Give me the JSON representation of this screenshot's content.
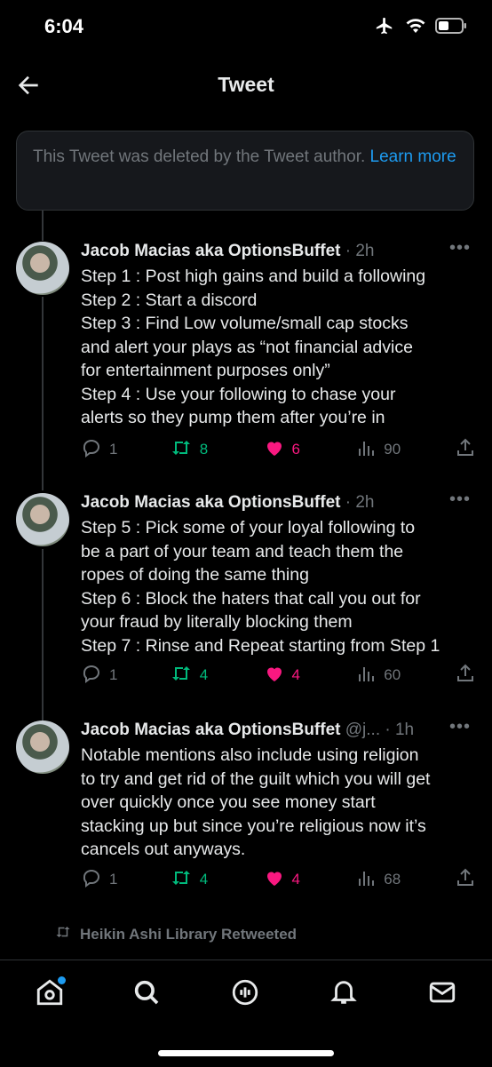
{
  "status_bar": {
    "time": "6:04"
  },
  "header": {
    "title": "Tweet"
  },
  "deleted_notice": {
    "text": "This Tweet was deleted by the Tweet author.",
    "link": "Learn more"
  },
  "tweets": [
    {
      "name": "Jacob Macias aka OptionsBuffet",
      "meta": " · 2h",
      "lines": [
        "Step 1 : Post high gains and build a following",
        "Step 2 : Start a discord",
        "Step 3 : Find Low volume/small cap stocks",
        "and alert your plays as “not financial advice",
        "for entertainment purposes only”",
        "Step 4 : Use your following to chase your",
        "alerts so they pump them after you’re in"
      ],
      "replies": "1",
      "retweets": "8",
      "likes": "6",
      "views": "90"
    },
    {
      "name": "Jacob Macias aka OptionsBuffet",
      "meta": " · 2h",
      "lines": [
        "Step 5 : Pick some of your loyal following to",
        "be a part of your team and teach them the",
        "ropes of doing the same thing",
        "Step 6 : Block the haters that call you out for",
        "your fraud by literally blocking them",
        "Step 7 : Rinse and Repeat starting from Step 1"
      ],
      "replies": "1",
      "retweets": "4",
      "likes": "4",
      "views": "60"
    },
    {
      "name": "Jacob Macias aka OptionsBuffet",
      "meta": " @j... · 1h",
      "lines": [
        "Notable mentions also include using religion",
        "to try and get rid of the guilt which you will get",
        "over quickly once you see money start",
        "stacking up but since you’re religious now it’s",
        "cancels out anyways."
      ],
      "replies": "1",
      "retweets": "4",
      "likes": "4",
      "views": "68"
    }
  ],
  "retweeted_by": "Heikin Ashi Library Retweeted",
  "icons": {
    "back": "arrow-left-icon",
    "more": "more-icon",
    "reply": "reply-icon",
    "retweet": "retweet-icon",
    "like": "heart-icon",
    "views": "views-icon",
    "share": "share-icon",
    "tabs": [
      "home-icon",
      "search-icon",
      "spaces-icon",
      "notifications-icon",
      "messages-icon"
    ]
  },
  "colors": {
    "link": "#1d9bf0",
    "retweet": "#00ba7c",
    "like": "#f91880",
    "muted": "#71767b"
  }
}
